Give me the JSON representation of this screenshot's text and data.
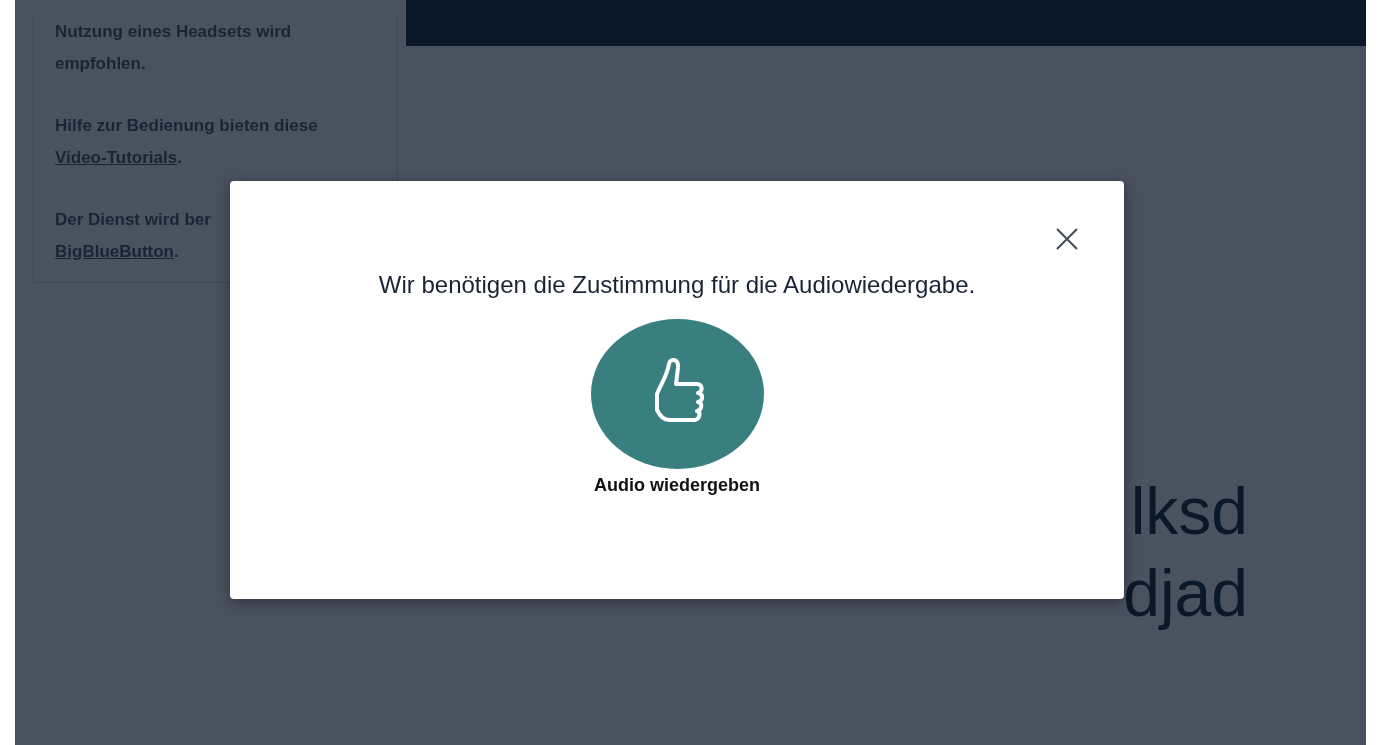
{
  "sidebar": {
    "paragraphs": [
      {
        "lines": [
          "Nutzung eines Headsets wird",
          "empfohlen."
        ]
      },
      {
        "lines": [
          "Hilfe zur Bedienung bieten diese"
        ],
        "link": "Video-Tutorials",
        "tail": "."
      },
      {
        "lines": [
          "Der Dienst wird ber"
        ],
        "link": "BigBlueButton",
        "tail": "."
      }
    ]
  },
  "main": {
    "lines": [
      "lksd",
      "djad"
    ]
  },
  "dialog": {
    "message": "Wir benötigen die Zustimmung für die Audiowiedergabe.",
    "button_label": "Audio wiedergeben"
  }
}
